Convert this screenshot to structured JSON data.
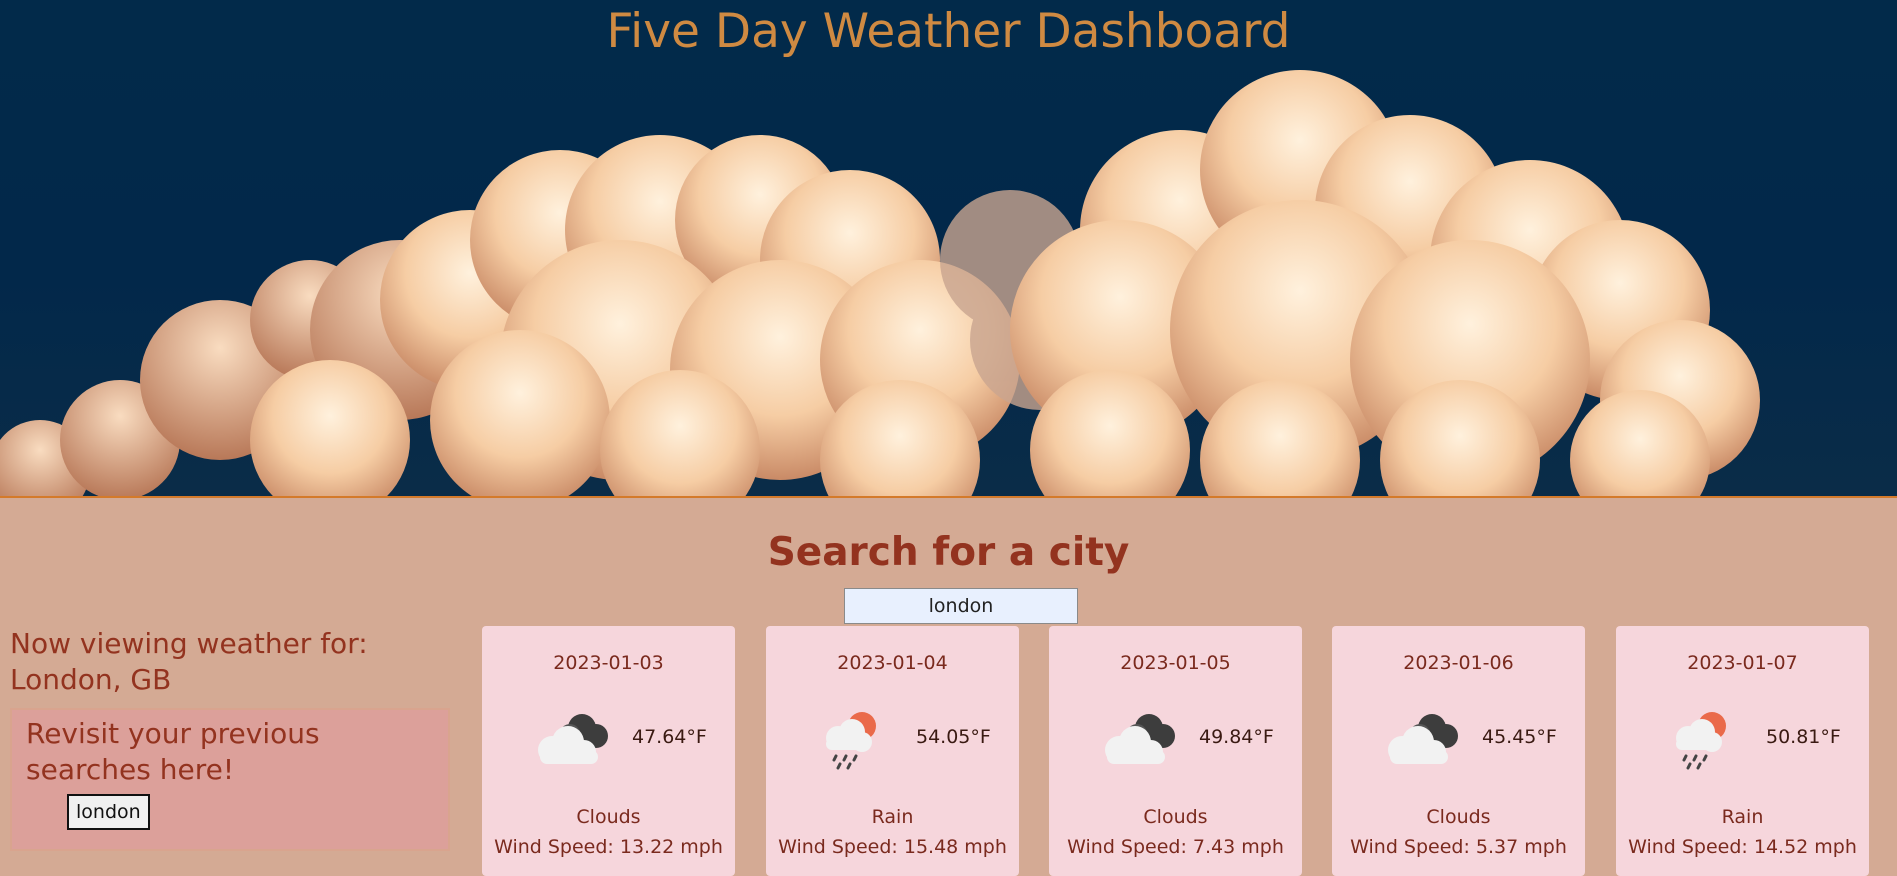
{
  "header": {
    "title": "Five Day Weather Dashboard"
  },
  "search": {
    "heading": "Search for a city",
    "value": "london"
  },
  "current": {
    "label": "Now viewing weather for:",
    "city": "London, GB"
  },
  "history": {
    "heading": "Revisit your previous searches here!",
    "items": [
      "london"
    ]
  },
  "forecast": [
    {
      "date": "2023-01-03",
      "icon": "clouds-icon",
      "temp": "47.64°F",
      "description": "Clouds",
      "wind": "Wind Speed: 13.22 mph"
    },
    {
      "date": "2023-01-04",
      "icon": "rain-icon",
      "temp": "54.05°F",
      "description": "Rain",
      "wind": "Wind Speed: 15.48 mph"
    },
    {
      "date": "2023-01-05",
      "icon": "clouds-icon",
      "temp": "49.84°F",
      "description": "Clouds",
      "wind": "Wind Speed: 7.43 mph"
    },
    {
      "date": "2023-01-06",
      "icon": "clouds-icon",
      "temp": "45.45°F",
      "description": "Clouds",
      "wind": "Wind Speed: 5.37 mph"
    },
    {
      "date": "2023-01-07",
      "icon": "rain-icon",
      "temp": "50.81°F",
      "description": "Rain",
      "wind": "Wind Speed: 14.52 mph"
    }
  ],
  "colors": {
    "accent": "#93331f",
    "title": "#cf8a42",
    "card": "#f6d6dc",
    "background": "#d4aa94",
    "sky": "#022a4a"
  }
}
